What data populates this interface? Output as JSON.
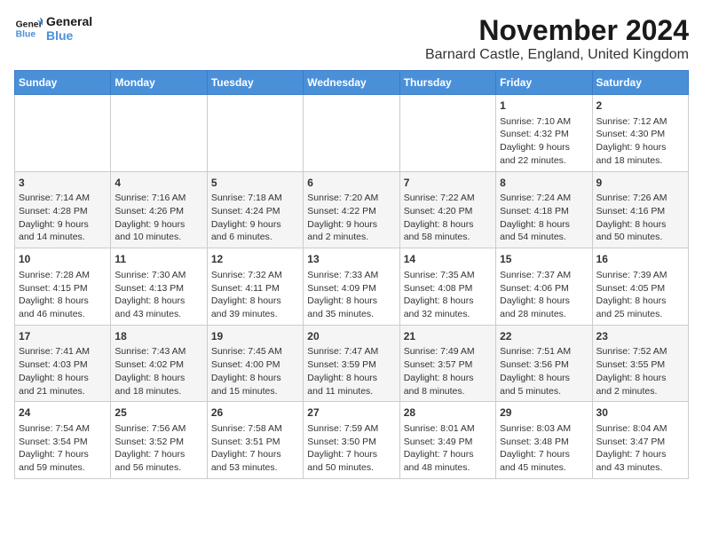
{
  "logo": {
    "line1": "General",
    "line2": "Blue"
  },
  "title": "November 2024",
  "subtitle": "Barnard Castle, England, United Kingdom",
  "days_of_week": [
    "Sunday",
    "Monday",
    "Tuesday",
    "Wednesday",
    "Thursday",
    "Friday",
    "Saturday"
  ],
  "weeks": [
    [
      {
        "day": "",
        "content": ""
      },
      {
        "day": "",
        "content": ""
      },
      {
        "day": "",
        "content": ""
      },
      {
        "day": "",
        "content": ""
      },
      {
        "day": "",
        "content": ""
      },
      {
        "day": "1",
        "content": "Sunrise: 7:10 AM\nSunset: 4:32 PM\nDaylight: 9 hours\nand 22 minutes."
      },
      {
        "day": "2",
        "content": "Sunrise: 7:12 AM\nSunset: 4:30 PM\nDaylight: 9 hours\nand 18 minutes."
      }
    ],
    [
      {
        "day": "3",
        "content": "Sunrise: 7:14 AM\nSunset: 4:28 PM\nDaylight: 9 hours\nand 14 minutes."
      },
      {
        "day": "4",
        "content": "Sunrise: 7:16 AM\nSunset: 4:26 PM\nDaylight: 9 hours\nand 10 minutes."
      },
      {
        "day": "5",
        "content": "Sunrise: 7:18 AM\nSunset: 4:24 PM\nDaylight: 9 hours\nand 6 minutes."
      },
      {
        "day": "6",
        "content": "Sunrise: 7:20 AM\nSunset: 4:22 PM\nDaylight: 9 hours\nand 2 minutes."
      },
      {
        "day": "7",
        "content": "Sunrise: 7:22 AM\nSunset: 4:20 PM\nDaylight: 8 hours\nand 58 minutes."
      },
      {
        "day": "8",
        "content": "Sunrise: 7:24 AM\nSunset: 4:18 PM\nDaylight: 8 hours\nand 54 minutes."
      },
      {
        "day": "9",
        "content": "Sunrise: 7:26 AM\nSunset: 4:16 PM\nDaylight: 8 hours\nand 50 minutes."
      }
    ],
    [
      {
        "day": "10",
        "content": "Sunrise: 7:28 AM\nSunset: 4:15 PM\nDaylight: 8 hours\nand 46 minutes."
      },
      {
        "day": "11",
        "content": "Sunrise: 7:30 AM\nSunset: 4:13 PM\nDaylight: 8 hours\nand 43 minutes."
      },
      {
        "day": "12",
        "content": "Sunrise: 7:32 AM\nSunset: 4:11 PM\nDaylight: 8 hours\nand 39 minutes."
      },
      {
        "day": "13",
        "content": "Sunrise: 7:33 AM\nSunset: 4:09 PM\nDaylight: 8 hours\nand 35 minutes."
      },
      {
        "day": "14",
        "content": "Sunrise: 7:35 AM\nSunset: 4:08 PM\nDaylight: 8 hours\nand 32 minutes."
      },
      {
        "day": "15",
        "content": "Sunrise: 7:37 AM\nSunset: 4:06 PM\nDaylight: 8 hours\nand 28 minutes."
      },
      {
        "day": "16",
        "content": "Sunrise: 7:39 AM\nSunset: 4:05 PM\nDaylight: 8 hours\nand 25 minutes."
      }
    ],
    [
      {
        "day": "17",
        "content": "Sunrise: 7:41 AM\nSunset: 4:03 PM\nDaylight: 8 hours\nand 21 minutes."
      },
      {
        "day": "18",
        "content": "Sunrise: 7:43 AM\nSunset: 4:02 PM\nDaylight: 8 hours\nand 18 minutes."
      },
      {
        "day": "19",
        "content": "Sunrise: 7:45 AM\nSunset: 4:00 PM\nDaylight: 8 hours\nand 15 minutes."
      },
      {
        "day": "20",
        "content": "Sunrise: 7:47 AM\nSunset: 3:59 PM\nDaylight: 8 hours\nand 11 minutes."
      },
      {
        "day": "21",
        "content": "Sunrise: 7:49 AM\nSunset: 3:57 PM\nDaylight: 8 hours\nand 8 minutes."
      },
      {
        "day": "22",
        "content": "Sunrise: 7:51 AM\nSunset: 3:56 PM\nDaylight: 8 hours\nand 5 minutes."
      },
      {
        "day": "23",
        "content": "Sunrise: 7:52 AM\nSunset: 3:55 PM\nDaylight: 8 hours\nand 2 minutes."
      }
    ],
    [
      {
        "day": "24",
        "content": "Sunrise: 7:54 AM\nSunset: 3:54 PM\nDaylight: 7 hours\nand 59 minutes."
      },
      {
        "day": "25",
        "content": "Sunrise: 7:56 AM\nSunset: 3:52 PM\nDaylight: 7 hours\nand 56 minutes."
      },
      {
        "day": "26",
        "content": "Sunrise: 7:58 AM\nSunset: 3:51 PM\nDaylight: 7 hours\nand 53 minutes."
      },
      {
        "day": "27",
        "content": "Sunrise: 7:59 AM\nSunset: 3:50 PM\nDaylight: 7 hours\nand 50 minutes."
      },
      {
        "day": "28",
        "content": "Sunrise: 8:01 AM\nSunset: 3:49 PM\nDaylight: 7 hours\nand 48 minutes."
      },
      {
        "day": "29",
        "content": "Sunrise: 8:03 AM\nSunset: 3:48 PM\nDaylight: 7 hours\nand 45 minutes."
      },
      {
        "day": "30",
        "content": "Sunrise: 8:04 AM\nSunset: 3:47 PM\nDaylight: 7 hours\nand 43 minutes."
      }
    ]
  ]
}
